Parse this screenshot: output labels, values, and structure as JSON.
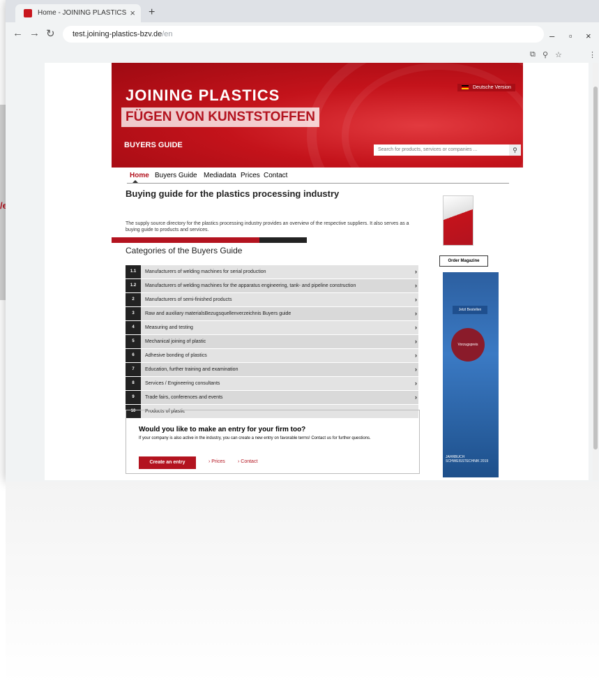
{
  "browser": {
    "tab_title": "Home - JOINING PLASTICS",
    "tab_close": "×",
    "new_tab": "+",
    "url_host": "test.joining-plastics-bzv.de",
    "url_path": "/en"
  },
  "side_label": "/en",
  "site": {
    "logo_line1": "JOINING PLASTICS",
    "logo_line2": "FÜGEN VON KUNSTSTOFFEN",
    "section": "BUYERS GUIDE",
    "language": "Deutsche Version",
    "search_placeholder": "Search for products, services or companies ...",
    "menu": [
      "Home",
      "Buyers Guide",
      "Mediadata",
      "Prices",
      "Contact"
    ],
    "heading": "Buying guide for the plastics processing industry",
    "intro": "The supply source directory for the plastics processing industry provides an overview of the respective suppliers. It also serves as a buying guide to products and services.",
    "categories_title": "Categories of the Buyers Guide",
    "categories": [
      {
        "num": "1.1",
        "label": "Manufacturers of welding machines for serial production"
      },
      {
        "num": "1.2",
        "label": "Manufacturers of welding machines for the apparatus engineering, tank- and pipeline construction"
      },
      {
        "num": "2",
        "label": "Manufacturers of semi-finished products"
      },
      {
        "num": "3",
        "label": "Raw and auxiliary materialsBezugsquellenverzeichnis Buyers guide"
      },
      {
        "num": "4",
        "label": "Measuring and testing"
      },
      {
        "num": "5",
        "label": "Mechanical joining of plastic"
      },
      {
        "num": "6",
        "label": "Adhesive bonding of plastics"
      },
      {
        "num": "7",
        "label": "Education, further training and examination"
      },
      {
        "num": "8",
        "label": "Services / Engineering consultants"
      },
      {
        "num": "9",
        "label": "Trade fairs, conferences and events"
      },
      {
        "num": "10",
        "label": "Products of plastic"
      }
    ],
    "entry": {
      "title": "Would you like to make an entry for your firm too?",
      "text": "If your company is also active in the industry, you can create a new entry on favorable terms! Contact us for further questions.",
      "button": "Create an entry",
      "link_prices": "› Prices",
      "link_contact": "› Contact"
    },
    "order_magazine": "Order Magazine",
    "ad": {
      "button": "Jetzt Bestellen",
      "circle": "Vorzugspreis",
      "footer": "JAHRBUCH SCHWEISSTECHNIK 2019"
    }
  },
  "colors": {
    "brand_red": "#b3131f",
    "dark": "#222222"
  }
}
